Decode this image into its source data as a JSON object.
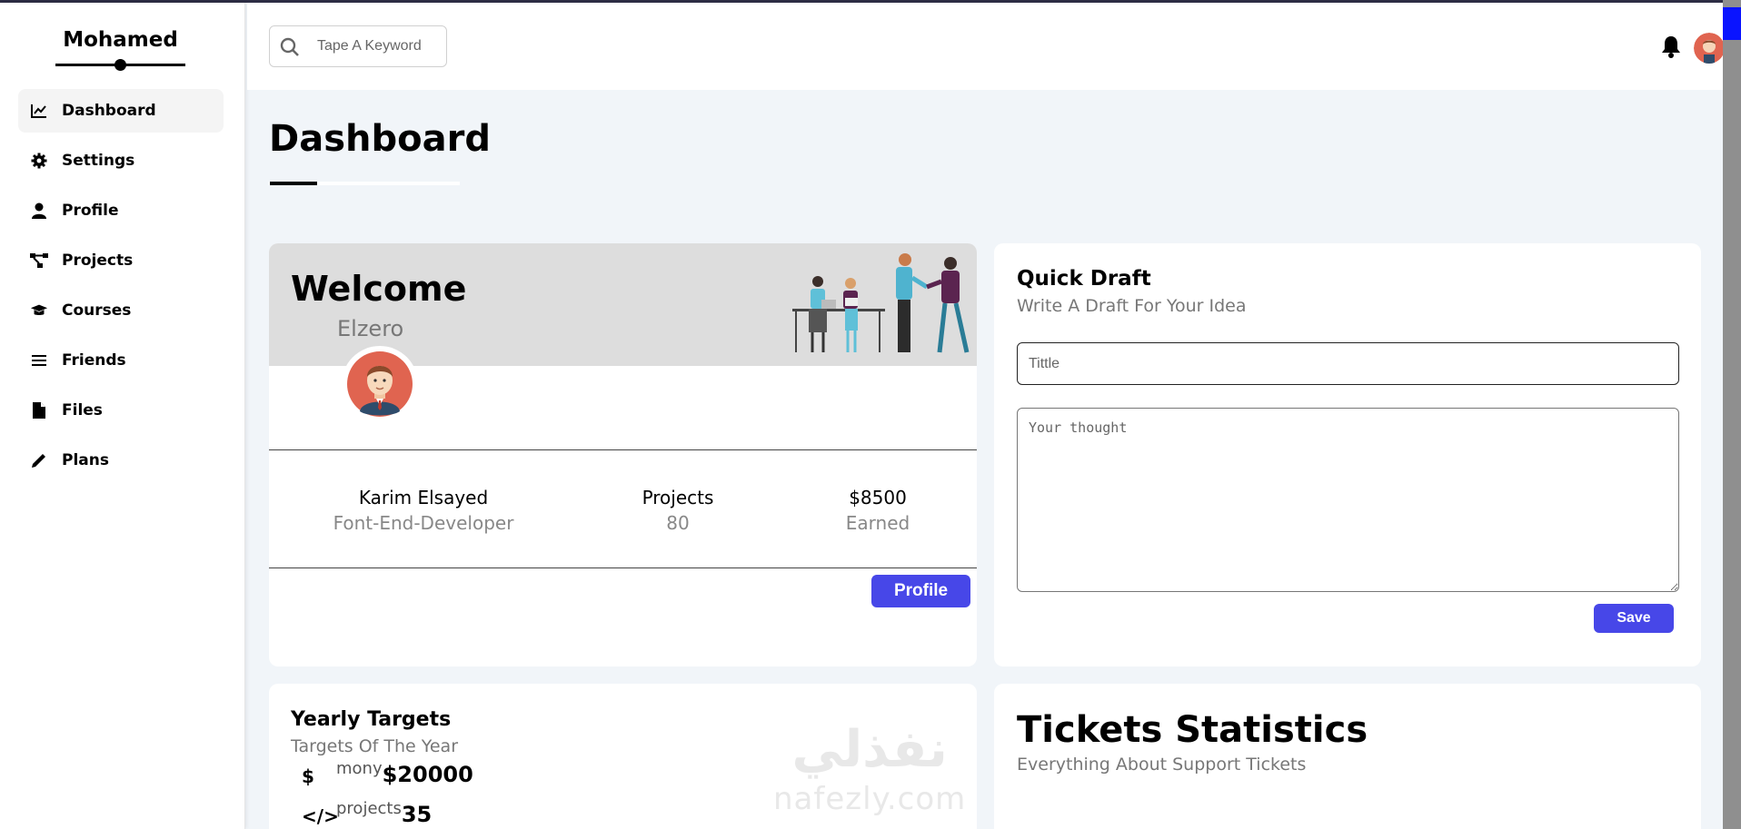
{
  "sidebar": {
    "brand": "Mohamed",
    "items": [
      {
        "label": "Dashboard",
        "icon": "chart-line-icon",
        "active": true
      },
      {
        "label": "Settings",
        "icon": "gear-icon"
      },
      {
        "label": "Profile",
        "icon": "user-icon"
      },
      {
        "label": "Projects",
        "icon": "diagram-project-icon"
      },
      {
        "label": "Courses",
        "icon": "graduation-cap-icon"
      },
      {
        "label": "Friends",
        "icon": "list-icon"
      },
      {
        "label": "Files",
        "icon": "file-icon"
      },
      {
        "label": "Plans",
        "icon": "pencil-icon"
      }
    ]
  },
  "header": {
    "search_placeholder": "Tape A Keyword"
  },
  "page": {
    "title": "Dashboard"
  },
  "welcome": {
    "title": "Welcome",
    "subtitle": "Elzero",
    "name": "Karim Elsayed",
    "role": "Font-End-Developer",
    "projects_label": "Projects",
    "projects_value": "80",
    "earned_value": "$8500",
    "earned_label": "Earned",
    "profile_button": "Profile"
  },
  "draft": {
    "title": "Quick Draft",
    "subtitle": "Write A Draft For Your Idea",
    "title_placeholder": "Tittle",
    "thought_placeholder": "Your thought",
    "save_button": "Save"
  },
  "targets": {
    "title": "Yearly Targets",
    "subtitle": "Targets Of The Year",
    "rows": [
      {
        "icon": "$",
        "label": "mony",
        "value": "$20000"
      },
      {
        "icon": "</>",
        "label": "projects",
        "value": "35"
      }
    ]
  },
  "watermark": {
    "arabic": "نفذلي",
    "latin": "nafezly.com"
  },
  "tickets": {
    "title": "Tickets Statistics",
    "subtitle": "Everything About Support Tickets"
  },
  "colors": {
    "accent": "#4747e8",
    "background": "#f1f5f9",
    "card_head": "#dddddd"
  }
}
